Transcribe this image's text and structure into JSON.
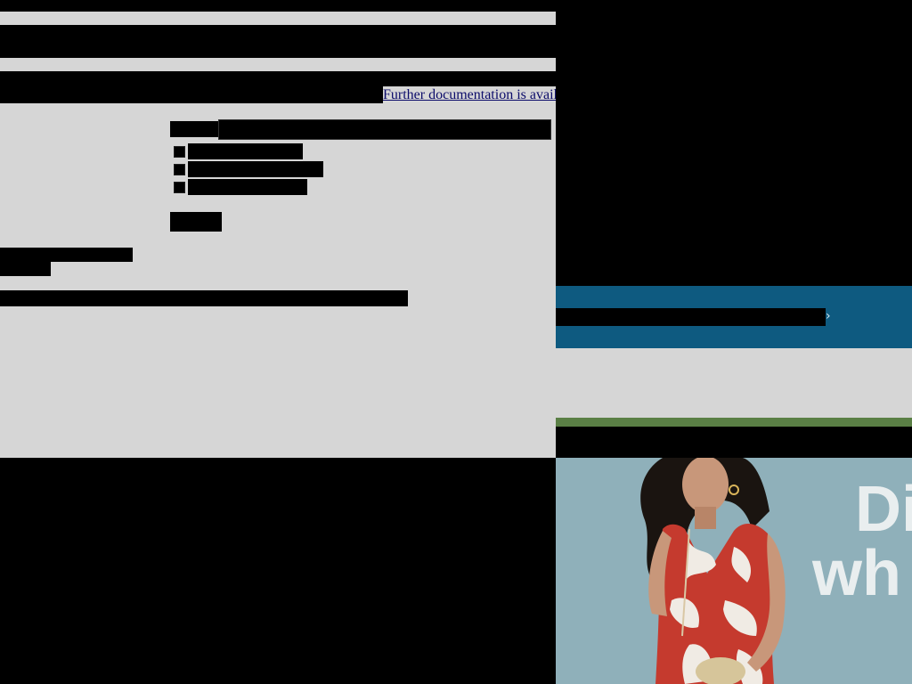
{
  "dialog": {
    "doc_link_text": "Further documentation is avail",
    "field_label": "",
    "field_value": "",
    "checkboxes": [
      {
        "label": ""
      },
      {
        "label": ""
      },
      {
        "label": ""
      }
    ],
    "submit_label": ""
  },
  "background_site": {
    "promo_banner": {
      "text": "",
      "arrow_glyph": "›",
      "color": "#0e5a80"
    },
    "accent_stripe_color": "#5a7f45",
    "hero": {
      "headline_line1": "Di",
      "headline_line2": "wh",
      "background_color": "#8fb0ba"
    }
  },
  "colors": {
    "dialog_background": "#d6d6d6",
    "link": "#0b0b6a",
    "redaction": "#000000"
  }
}
